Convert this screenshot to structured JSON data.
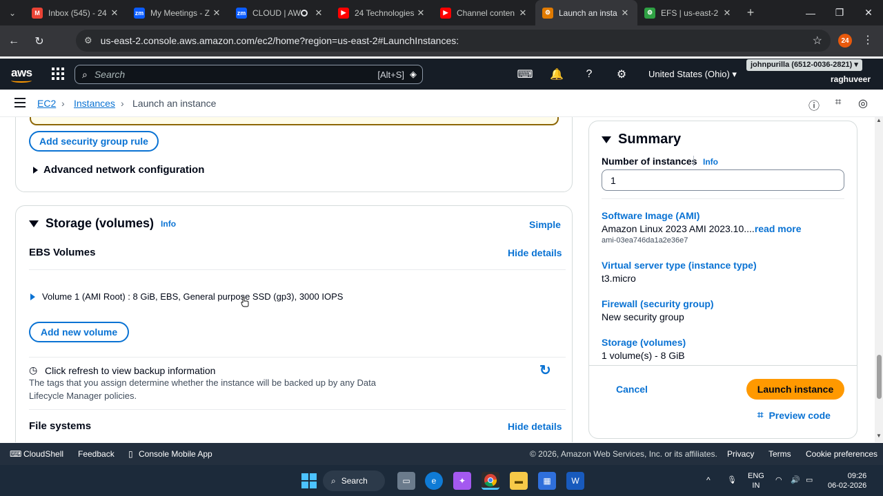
{
  "browser": {
    "tabs": [
      {
        "title": "Inbox (545) - 24",
        "icon": "gmail-icon",
        "color": "#ea4335",
        "glyph": "M"
      },
      {
        "title": "My Meetings - Z",
        "icon": "zoom-icon",
        "color": "#0b5cff",
        "glyph": "zm"
      },
      {
        "title": "CLOUD | AW",
        "icon": "zoom-icon",
        "color": "#0b5cff",
        "glyph": "zm"
      },
      {
        "title": "24 Technologies",
        "icon": "youtube-icon",
        "color": "#ff0000",
        "glyph": "▶"
      },
      {
        "title": "Channel conten",
        "icon": "youtube-icon",
        "color": "#ff0000",
        "glyph": "▶"
      },
      {
        "title": "Launch an insta",
        "icon": "ec2-icon",
        "color": "#e07a00",
        "glyph": "⚙"
      },
      {
        "title": "EFS | us-east-2",
        "icon": "efs-icon",
        "color": "#2ea043",
        "glyph": "⚙"
      }
    ],
    "url": "us-east-2.console.aws.amazon.com/ec2/home?region=us-east-2#LaunchInstances:",
    "profile_badge": "24"
  },
  "aws_nav": {
    "logo": "aws",
    "search_placeholder": "Search",
    "search_hint": "[Alt+S]",
    "region": "United States (Ohio) ▾",
    "account": "johnpurilla (6512-0036-2821) ▾",
    "user": "raghuveer"
  },
  "breadcrumb": {
    "items": [
      "EC2",
      "Instances",
      "Launch an instance"
    ]
  },
  "network": {
    "add_rule": "Add security group rule",
    "advanced": "Advanced network configuration"
  },
  "storage": {
    "title": "Storage (volumes)",
    "info": "Info",
    "simple": "Simple",
    "ebs_label": "EBS Volumes",
    "hide_details": "Hide details",
    "volume1": "Volume 1 (AMI Root) : 8 GiB, EBS, General purpose SSD (gp3), 3000 IOPS",
    "add_volume": "Add new volume",
    "backup_title": "Click refresh to view backup information",
    "backup_desc_1": "The tags that you assign determine whether the instance will be backed up by any Data",
    "backup_desc_2": "Lifecycle Manager policies.",
    "file_systems": "File systems",
    "fs_hide": "Hide details"
  },
  "summary": {
    "title": "Summary",
    "num_instances_label": "Number of instances",
    "info": "Info",
    "num_instances": "1",
    "ami_label": "Software Image (AMI)",
    "ami_value": "Amazon Linux 2023 AMI 2023.10....",
    "read_more": "read more",
    "ami_id": "ami-03ea746da1a2e36e7",
    "type_label": "Virtual server type (instance type)",
    "type_value": "t3.micro",
    "firewall_label": "Firewall (security group)",
    "firewall_value": "New security group",
    "storage_label": "Storage (volumes)",
    "storage_value": "1 volume(s) - 8 GiB",
    "cancel": "Cancel",
    "launch": "Launch instance",
    "preview": "Preview code"
  },
  "footer": {
    "cloudshell": "CloudShell",
    "feedback": "Feedback",
    "mobile": "Console Mobile App",
    "copyright": "© 2026, Amazon Web Services, Inc. or its affiliates.",
    "privacy": "Privacy",
    "terms": "Terms",
    "cookies": "Cookie preferences"
  },
  "taskbar": {
    "search": "Search",
    "lang1": "ENG",
    "lang2": "IN",
    "time": "09:26",
    "date": "06-02-2026"
  },
  "colors": {
    "accent": "#0972d3",
    "launch": "#ff9900",
    "aws_nav": "#161d26"
  }
}
